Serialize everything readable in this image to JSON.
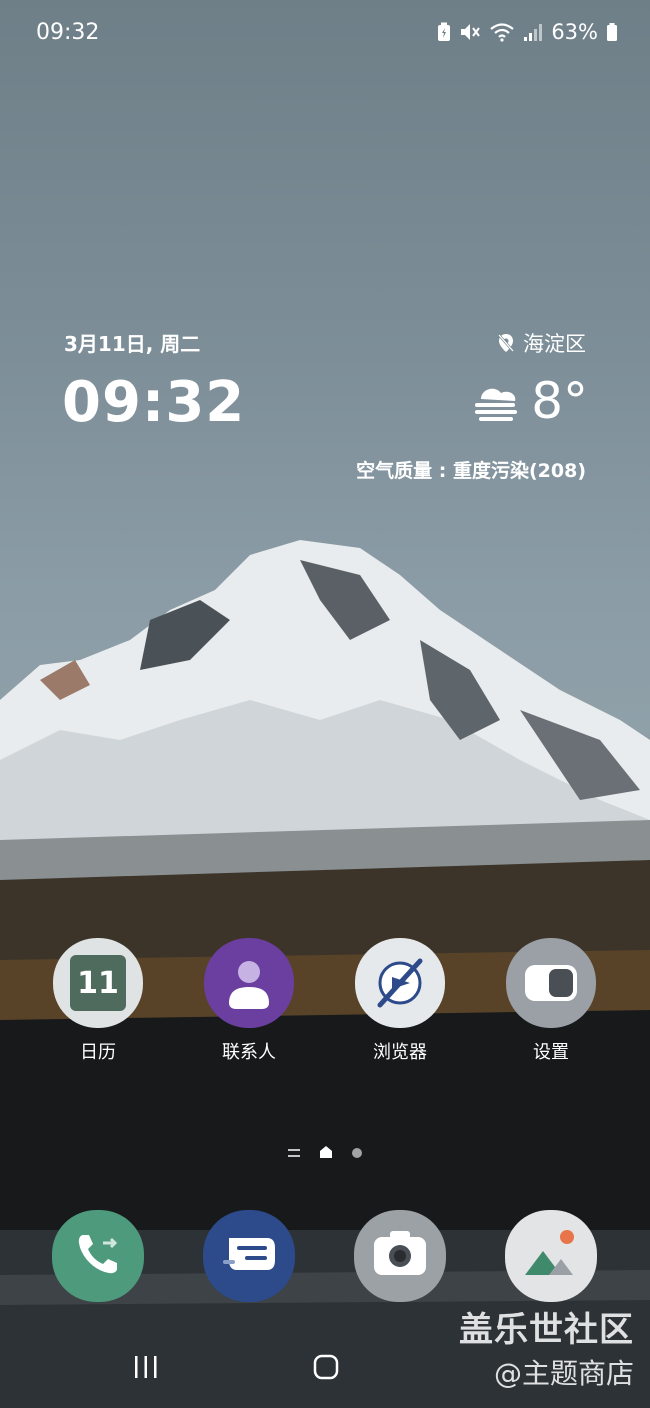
{
  "status_bar": {
    "time": "09:32",
    "battery": "63%",
    "icons": [
      "battery-saver-icon",
      "mute-icon",
      "wifi-icon",
      "signal-icon",
      "battery-icon"
    ]
  },
  "widget": {
    "date": "3月11日, 周二",
    "clock": "09:32",
    "location": "海淀区",
    "weather_icon": "fog-icon",
    "temperature": "8°",
    "air_quality": "空气质量 : 重度污染(208)"
  },
  "apps": [
    {
      "label": "日历",
      "icon": "calendar-icon",
      "badge": "11"
    },
    {
      "label": "联系人",
      "icon": "contacts-icon"
    },
    {
      "label": "浏览器",
      "icon": "browser-icon"
    },
    {
      "label": "设置",
      "icon": "settings-icon"
    }
  ],
  "dock": [
    {
      "icon": "phone-icon"
    },
    {
      "icon": "messages-icon"
    },
    {
      "icon": "camera-icon"
    },
    {
      "icon": "gallery-icon"
    }
  ],
  "watermark": {
    "line1": "盖乐世社区",
    "line2": "@主题商店"
  },
  "colors": {
    "phone": "#4e9a7c",
    "messages": "#2d4a8a",
    "contacts": "#6a3fa0",
    "calendar": "#4f6b5d"
  }
}
